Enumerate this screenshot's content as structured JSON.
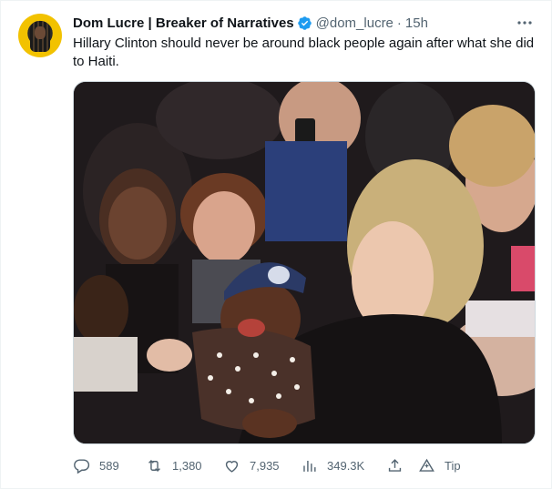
{
  "tweet": {
    "author": {
      "display_name": "Dom Lucre | Breaker of Narratives",
      "verified_icon": "verified-badge-icon",
      "handle": "@dom_lucre",
      "separator": "·",
      "time": "15h"
    },
    "more_icon": "more-options-icon",
    "text": "Hillary Clinton should never be around black people again after what she did to Haiti.",
    "media": {
      "type": "photo"
    },
    "actions": {
      "reply_count": "589",
      "retweet_count": "1,380",
      "like_count": "7,935",
      "views_count": "349.3K",
      "share_icon": "share-icon",
      "tip_label": "Tip"
    }
  },
  "colors": {
    "text_primary": "#0f1419",
    "text_secondary": "#536471",
    "verified_blue": "#1d9bf0",
    "border": "#eff3f4"
  }
}
